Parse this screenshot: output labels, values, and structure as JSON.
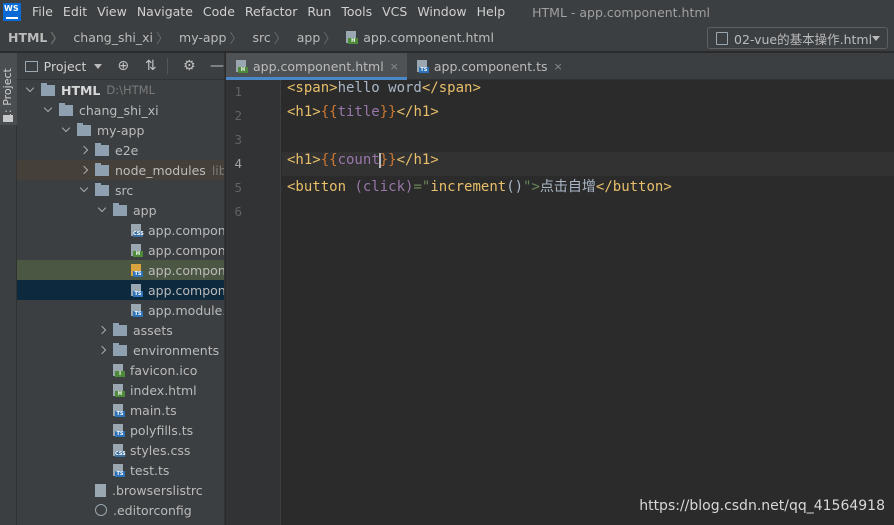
{
  "menubar": {
    "logo_text": "WS",
    "items": [
      "File",
      "Edit",
      "View",
      "Navigate",
      "Code",
      "Refactor",
      "Run",
      "Tools",
      "VCS",
      "Window",
      "Help"
    ],
    "window_title": "HTML - app.component.html"
  },
  "navbar": {
    "crumbs": [
      "HTML",
      "chang_shi_xi",
      "my-app",
      "src",
      "app",
      "app.component.html"
    ],
    "run_config": "02-vue的基本操作.html"
  },
  "sidestrip": {
    "label": "1: Project"
  },
  "project_panel": {
    "title": "Project",
    "tree": [
      {
        "name": "HTML",
        "path": "D:\\HTML"
      },
      {
        "name": "chang_shi_xi"
      },
      {
        "name": "my-app"
      },
      {
        "name": "e2e"
      },
      {
        "name": "node_modules",
        "extra": "library root"
      },
      {
        "name": "src"
      },
      {
        "name": "app"
      },
      {
        "name": "app.component.css"
      },
      {
        "name": "app.component.html"
      },
      {
        "name": "app.component.spec.ts"
      },
      {
        "name": "app.component.ts"
      },
      {
        "name": "app.module.ts"
      },
      {
        "name": "assets"
      },
      {
        "name": "environments"
      },
      {
        "name": "favicon.ico"
      },
      {
        "name": "index.html"
      },
      {
        "name": "main.ts"
      },
      {
        "name": "polyfills.ts"
      },
      {
        "name": "styles.css"
      },
      {
        "name": "test.ts"
      },
      {
        "name": ".browserslistrc"
      },
      {
        "name": ".editorconfig"
      }
    ]
  },
  "editor_tabs": [
    {
      "label": "app.component.html",
      "close": "×"
    },
    {
      "label": "app.component.ts",
      "close": "×"
    }
  ],
  "editor": {
    "line_numbers": [
      "1",
      "2",
      "3",
      "4",
      "5",
      "6"
    ],
    "code": {
      "l1_open": "<span>",
      "l1_text": "hello word",
      "l1_close": "</span>",
      "l2_open": "<h1>",
      "l2_lb": "{{",
      "l2_expr": "title",
      "l2_rb": "}}",
      "l2_close": "</h1>",
      "l4_open": "<h1>",
      "l4_lb": "{{",
      "l4_expr": "count",
      "l4_rb": "}}",
      "l4_close": "</h1>",
      "l5_open": "<button",
      "l5_attr": "(click)",
      "l5_eq": "=\"",
      "l5_fn": "increment",
      "l5_paren": "()",
      "l5_q": "\">",
      "l5_text": "点击自增",
      "l5_close": "</button>"
    }
  },
  "watermark": "https://blog.csdn.net/qq_41564918",
  "colors": {
    "tag": "#e8bf6a",
    "interpolation": "#cc7832",
    "expression": "#9876aa",
    "string": "#6a8759",
    "active_tab_underline": "#4a88c7"
  }
}
